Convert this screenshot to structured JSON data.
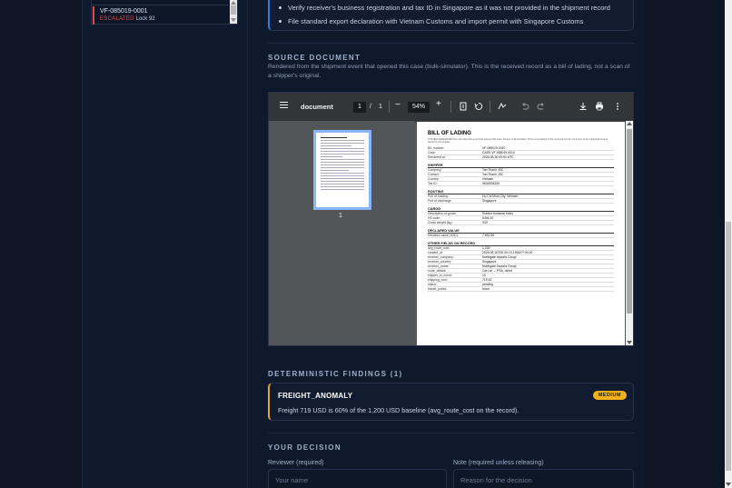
{
  "case_list": {
    "items": [
      {
        "id": "VF-085019-0001",
        "status": "ESCALATED",
        "lock": "Lock 92"
      }
    ]
  },
  "checklist": {
    "items": [
      "Verify receiver's business registration and tax ID in Singapore as it was not provided in the shipment record",
      "File standard export declaration with Vietnam Customs and import permit with Singapore Customs"
    ]
  },
  "source": {
    "title": "SOURCE DOCUMENT",
    "description": "Rendered from the shipment event that opened this case (bulk-simulator). This is the received record as a bill of lading, not a scan of a shipper's original."
  },
  "pdf_viewer": {
    "doc_title": "document",
    "page_current": "1",
    "page_separator": "/",
    "page_total": "1",
    "zoom": "54%",
    "thumbnail_page": "1",
    "page": {
      "title": "BILL OF LADING",
      "note": "SYSTEM-GENERATED from the shipment event that opened this case. Source: bulk-simulator. This is a rendering of the received record, not a scan of an original document issued by the shipper.",
      "header_rows": [
        {
          "k": "B/L number:",
          "v": "VF-085019-0010"
        },
        {
          "k": "Case:",
          "v": "CASE-VF-085019-0010"
        },
        {
          "k": "Rendered at:",
          "v": "2026-08-30 09:50 UTC"
        }
      ],
      "sections": [
        {
          "title": "SHIPPER",
          "rows": [
            {
              "k": "Company:",
              "v": "Tan Thanh JSC"
            },
            {
              "k": "Contact:",
              "v": "Tan Thanh JSC"
            },
            {
              "k": "Country:",
              "v": "Vietnam"
            },
            {
              "k": "Tax ID:",
              "v": "0630008335"
            }
          ]
        },
        {
          "title": "ROUTING",
          "rows": [
            {
              "k": "Port of loading:",
              "v": "Ho Chi Minh City, Vietnam"
            },
            {
              "k": "Port of discharge:",
              "v": "Singapore"
            }
          ]
        },
        {
          "title": "CARGO",
          "rows": [
            {
              "k": "Description of goods:",
              "v": "Rubber footwear soles"
            },
            {
              "k": "HS code:",
              "v": "6406.20"
            },
            {
              "k": "Gross weight (kg):",
              "v": "343"
            }
          ]
        },
        {
          "title": "DECLARED VALUE",
          "rows": [
            {
              "k": "Declared value (USD):",
              "v": "7,692.56"
            }
          ]
        },
        {
          "title": "OTHER FIELDS ON RECORD",
          "rows": [
            {
              "k": "avg_route_cost:",
              "v": "1,200"
            },
            {
              "k": "created_at:",
              "v": "2026-08-30T00:30:19.130627+00:00"
            },
            {
              "k": "receiver_company:",
              "v": "Northgate Imports Group"
            },
            {
              "k": "receiver_country:",
              "v": "Singapore"
            },
            {
              "k": "receiver_name:",
              "v": "Northgate Imports Group"
            },
            {
              "k": "route_details:",
              "v": "Cat Lai → PSA, direct"
            },
            {
              "k": "shipper_tx_count:",
              "v": "15"
            },
            {
              "k": "shipping_cost:",
              "v": "719.42"
            },
            {
              "k": "status:",
              "v": "pending"
            },
            {
              "k": "transit_points:",
              "v": "None"
            }
          ]
        }
      ]
    }
  },
  "findings": {
    "title": "DETERMINISTIC FINDINGS (1)",
    "items": [
      {
        "code": "FREIGHT_ANOMALY",
        "severity": "MEDIUM",
        "text": "Freight 719 USD is 60% of the 1,200 USD baseline (avg_route_cost on the record)."
      }
    ]
  },
  "decision": {
    "title": "YOUR DECISION",
    "reviewer_label": "Reviewer (required)",
    "reviewer_placeholder": "Your name",
    "note_label": "Note (required unless releasing)",
    "note_placeholder": "Reason for the decision"
  },
  "colors": {
    "background": "#0e1525",
    "panel": "#0f192c",
    "accent_blue": "#2f7be0",
    "escalated_red": "#e24a4a",
    "medium_badge": "#f3b11b"
  }
}
